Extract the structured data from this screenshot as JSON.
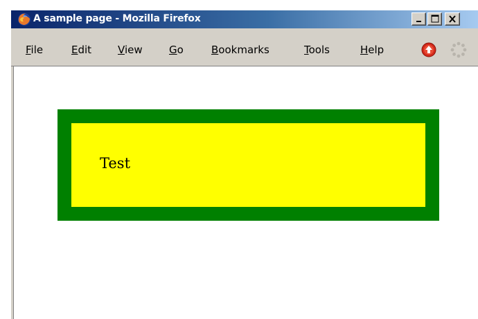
{
  "window": {
    "title": "A sample page - Mozilla Firefox"
  },
  "menu": {
    "items": [
      {
        "accel": "F",
        "rest": "ile"
      },
      {
        "accel": "E",
        "rest": "dit"
      },
      {
        "accel": "V",
        "rest": "iew"
      },
      {
        "accel": "G",
        "rest": "o"
      },
      {
        "accel": "B",
        "rest": "ookmarks"
      },
      {
        "accel": "T",
        "rest": "ools"
      },
      {
        "accel": "H",
        "rest": "elp"
      }
    ]
  },
  "page": {
    "text": "Test",
    "outer_color": "#008000",
    "inner_color": "#ffff00"
  },
  "icons": {
    "app": "firefox-icon",
    "stop": "stop-icon",
    "throbber": "throbber-icon"
  }
}
